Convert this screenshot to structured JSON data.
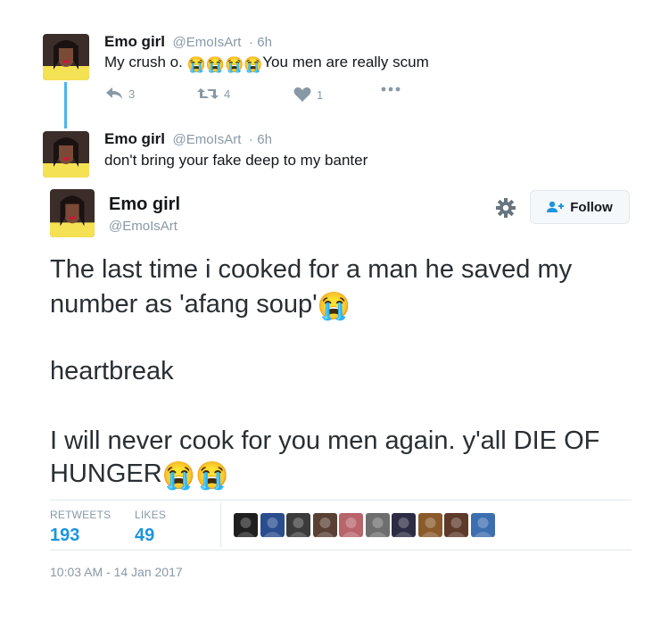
{
  "replies": [
    {
      "name": "Emo girl",
      "handle": "@EmoIsArt",
      "time": "6h",
      "text_before": "My crush o.",
      "emoji": "😭",
      "emoji_count": 4,
      "text_after": "You men are really scum",
      "actions": {
        "reply_count": "3",
        "retweet_count": "4",
        "like_count": "1"
      }
    },
    {
      "name": "Emo girl",
      "handle": "@EmoIsArt",
      "time": "6h",
      "text": "don't bring your fake deep to my banter"
    }
  ],
  "main": {
    "name": "Emo girl",
    "handle": "@EmoIsArt",
    "follow_label": "Follow",
    "line1": "The last time i cooked for a man he saved my",
    "line2": "number as 'afang soup'",
    "line3": "heartbreak",
    "line4": "I will never cook for you men again. y'all DIE OF",
    "line5": "HUNGER",
    "emoji": "😭",
    "stats": {
      "retweets_label": "RETWEETS",
      "retweets_value": "193",
      "likes_label": "LIKES",
      "likes_value": "49"
    },
    "timestamp": "10:03 AM - 14 Jan 2017"
  },
  "colors": {
    "accent": "#1b95e0",
    "thread_line": "#4ab3f4",
    "muted": "#8899a6",
    "avatar_yellow": "#f5e154"
  },
  "icons": [
    "reply-icon",
    "retweet-icon",
    "heart-icon",
    "more-icon",
    "gear-icon",
    "follow-person-icon"
  ],
  "likers_count": 10
}
